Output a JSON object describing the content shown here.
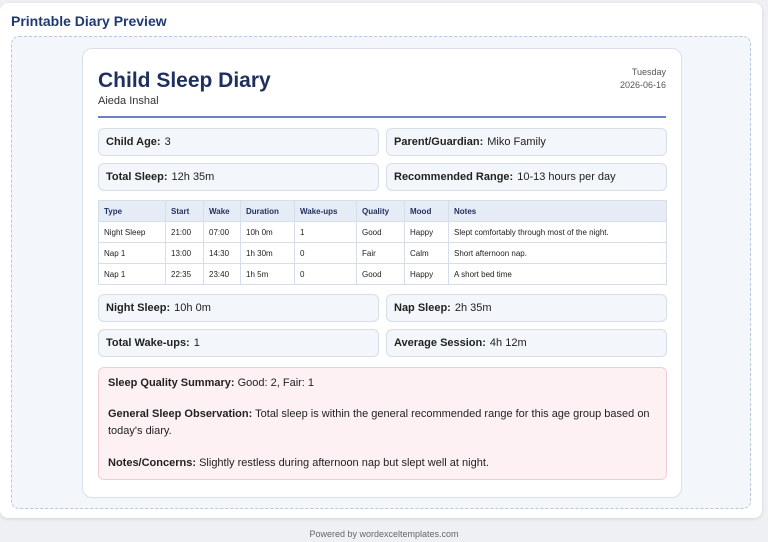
{
  "app": {
    "title": "Printable Diary Preview"
  },
  "diary": {
    "title": "Child Sleep Diary",
    "child_name": "Aieda Inshal",
    "day": "Tuesday",
    "date": "2026-06-16"
  },
  "info": {
    "child_age_label": "Child Age:",
    "child_age": "3",
    "parent_label": "Parent/Guardian:",
    "parent": "Miko Family",
    "total_sleep_label": "Total Sleep:",
    "total_sleep": "12h 35m",
    "recommended_label": "Recommended Range:",
    "recommended": "10-13 hours per day"
  },
  "table": {
    "headers": [
      "Type",
      "Start",
      "Wake",
      "Duration",
      "Wake-ups",
      "Quality",
      "Mood",
      "Notes"
    ],
    "rows": [
      [
        "Night Sleep",
        "21:00",
        "07:00",
        "10h 0m",
        "1",
        "Good",
        "Happy",
        "Slept comfortably through most of the night."
      ],
      [
        "Nap 1",
        "13:00",
        "14:30",
        "1h 30m",
        "0",
        "Fair",
        "Calm",
        "Short afternoon nap."
      ],
      [
        "Nap 1",
        "22:35",
        "23:40",
        "1h 5m",
        "0",
        "Good",
        "Happy",
        "A short bed time"
      ]
    ]
  },
  "stats": {
    "night_label": "Night Sleep:",
    "night": "10h 0m",
    "nap_label": "Nap Sleep:",
    "nap": "2h 35m",
    "wakeups_label": "Total Wake-ups:",
    "wakeups": "1",
    "avg_label": "Average Session:",
    "avg": "4h 12m"
  },
  "summary": {
    "quality_label": "Sleep Quality Summary:",
    "quality": "Good: 2, Fair: 1",
    "observation_label": "General Sleep Observation:",
    "observation": "Total sleep is within the general recommended range for this age group based on today's diary.",
    "notes_label": "Notes/Concerns:",
    "notes": "Slightly restless during afternoon nap but slept well at night."
  },
  "footer": {
    "text": "Powered by wordexceltemplates.com"
  }
}
